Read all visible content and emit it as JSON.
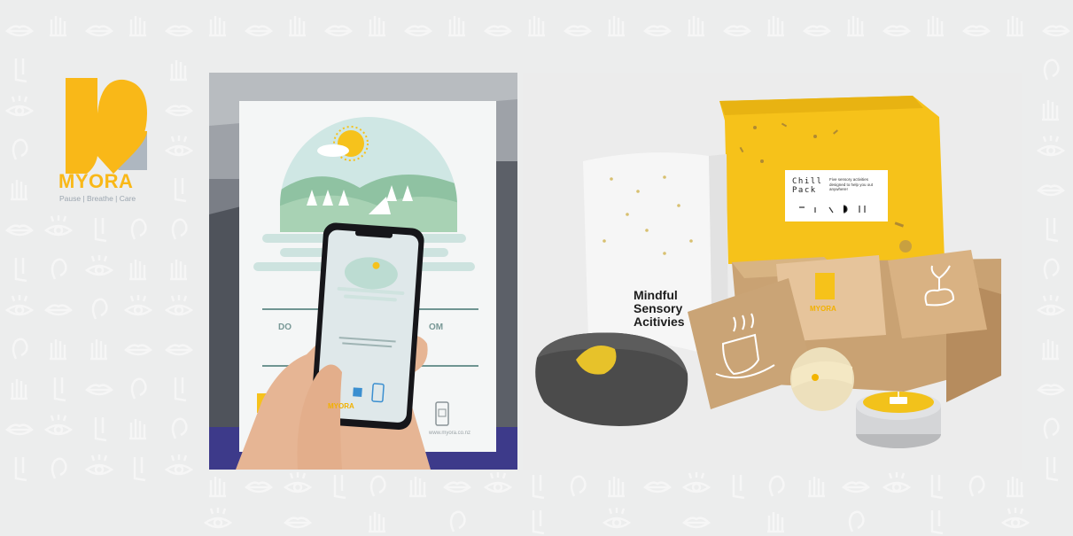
{
  "brand": {
    "name": "MYORA",
    "tagline": "Pause | Breathe | Care",
    "primary_color": "#f9b818",
    "secondary_color": "#aeb7c0"
  },
  "poster": {
    "phone_brand": "MYORA",
    "url": "www.myora.co.nz"
  },
  "pack": {
    "booklet_title_lines": [
      "Mindful",
      "Sensory",
      "Acitivies"
    ],
    "label_title_lines": [
      "Chill",
      "Pack"
    ],
    "label_description": "Five sensory activities designed to help you out anywhere!",
    "card_brand": "MYORA"
  }
}
